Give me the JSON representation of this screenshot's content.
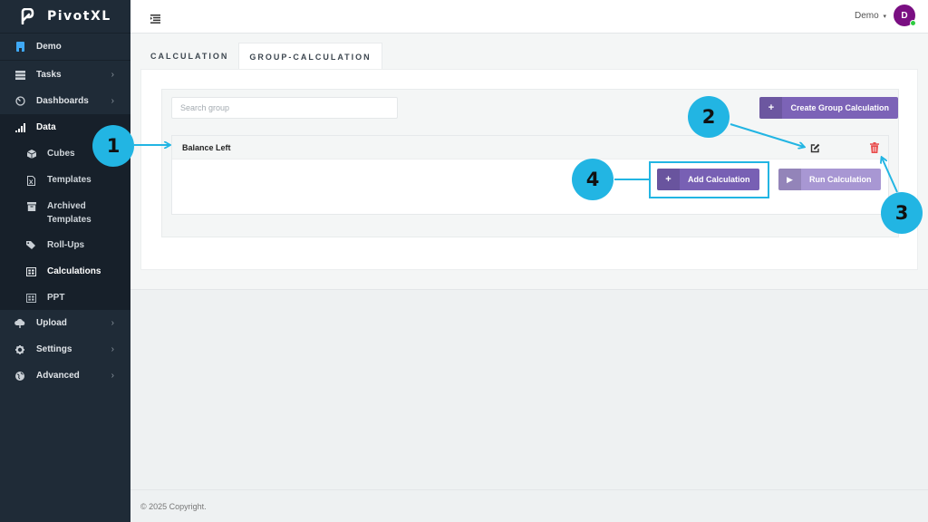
{
  "app": {
    "name": "PivotXL"
  },
  "sidebar": {
    "items": [
      {
        "label": "Demo",
        "icon": "book-icon",
        "has_children": false
      },
      {
        "label": "Tasks",
        "icon": "server-icon",
        "has_children": true
      },
      {
        "label": "Dashboards",
        "icon": "gauge-icon",
        "has_children": true
      },
      {
        "label": "Data",
        "icon": "signal-icon",
        "has_children": false,
        "expanded": true
      },
      {
        "label": "Upload",
        "icon": "cloud-upload-icon",
        "has_children": true
      },
      {
        "label": "Settings",
        "icon": "gear-icon",
        "has_children": true
      },
      {
        "label": "Advanced",
        "icon": "globe-icon",
        "has_children": true
      }
    ],
    "data_subitems": [
      {
        "label": "Cubes",
        "icon": "cube-icon"
      },
      {
        "label": "Templates",
        "icon": "file-excel-icon"
      },
      {
        "label": "Archived Templates",
        "icon": "archive-icon"
      },
      {
        "label": "Roll-Ups",
        "icon": "tags-icon"
      },
      {
        "label": "Calculations",
        "icon": "table-icon",
        "active": true
      },
      {
        "label": "PPT",
        "icon": "table-icon"
      }
    ],
    "chevron": "›"
  },
  "header": {
    "user_name": "Demo",
    "caret": "▾",
    "avatar_initial": "D",
    "avatar_color": "#7a0f82",
    "status_color": "#2ecc40"
  },
  "tabs": [
    {
      "label": "CALCULATION",
      "active": false
    },
    {
      "label": "GROUP-CALCULATION",
      "active": true
    }
  ],
  "group_panel": {
    "search_placeholder": "Search group",
    "search_value": "",
    "create_button": {
      "icon": "+",
      "label": "Create Group Calculation"
    },
    "groups": [
      {
        "name": "Balance Left",
        "add_button": {
          "icon": "+",
          "label": "Add Calculation"
        },
        "run_button": {
          "icon": "▶",
          "label": "Run Calculation"
        }
      }
    ]
  },
  "footer": {
    "copyright": "© 2025 Copyright."
  },
  "annotations": {
    "color": "#22b5e3",
    "callouts": [
      "1",
      "2",
      "3",
      "4"
    ]
  },
  "colors": {
    "sidebar_bg": "#1f2b37",
    "primary_button": "#7c63b7",
    "disabled_button": "#a897d3",
    "delete_icon": "#e84b4b"
  }
}
